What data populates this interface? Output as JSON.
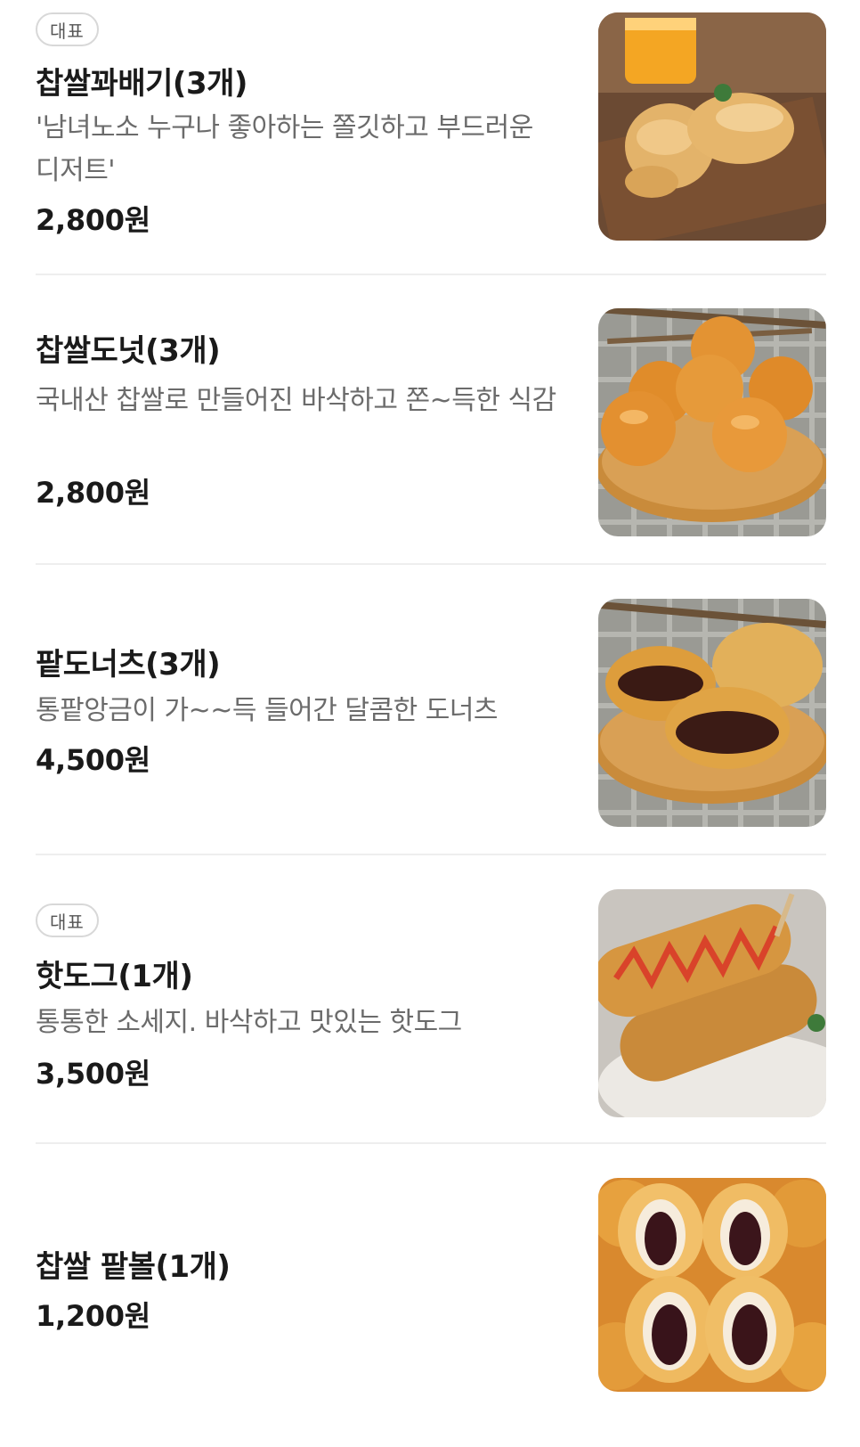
{
  "menu": {
    "items": [
      {
        "badge": "대표",
        "name": "찹쌀꽈배기(3개)",
        "description": "'남녀노소 누구나 좋아하는 쫄깃하고 부드러운 디저트'",
        "price": "2,800원",
        "image_icon": "twisted-donut-photo"
      },
      {
        "badge": "",
        "name": "찹쌀도넛(3개)",
        "description": "국내산 찹쌀로 만들어진 바삭하고 쫀~득한 식감",
        "price": "2,800원",
        "image_icon": "round-donut-photo"
      },
      {
        "badge": "",
        "name": "팥도너츠(3개)",
        "description": "통팥앙금이 가~~득 들어간 달콤한 도너츠",
        "price": "4,500원",
        "image_icon": "red-bean-donut-photo"
      },
      {
        "badge": "대표",
        "name": "핫도그(1개)",
        "description": "통통한 소세지. 바삭하고 맛있는 핫도그",
        "price": "3,500원",
        "image_icon": "hotdog-photo"
      },
      {
        "badge": "",
        "name": "찹쌀 팥볼(1개)",
        "description": "",
        "price": "1,200원",
        "image_icon": "red-bean-ball-photo"
      }
    ]
  },
  "colors": {
    "text_primary": "#1a1a1a",
    "text_secondary": "#6b6b6b",
    "badge_border": "#d8d8d8",
    "divider": "#eeeeee"
  }
}
